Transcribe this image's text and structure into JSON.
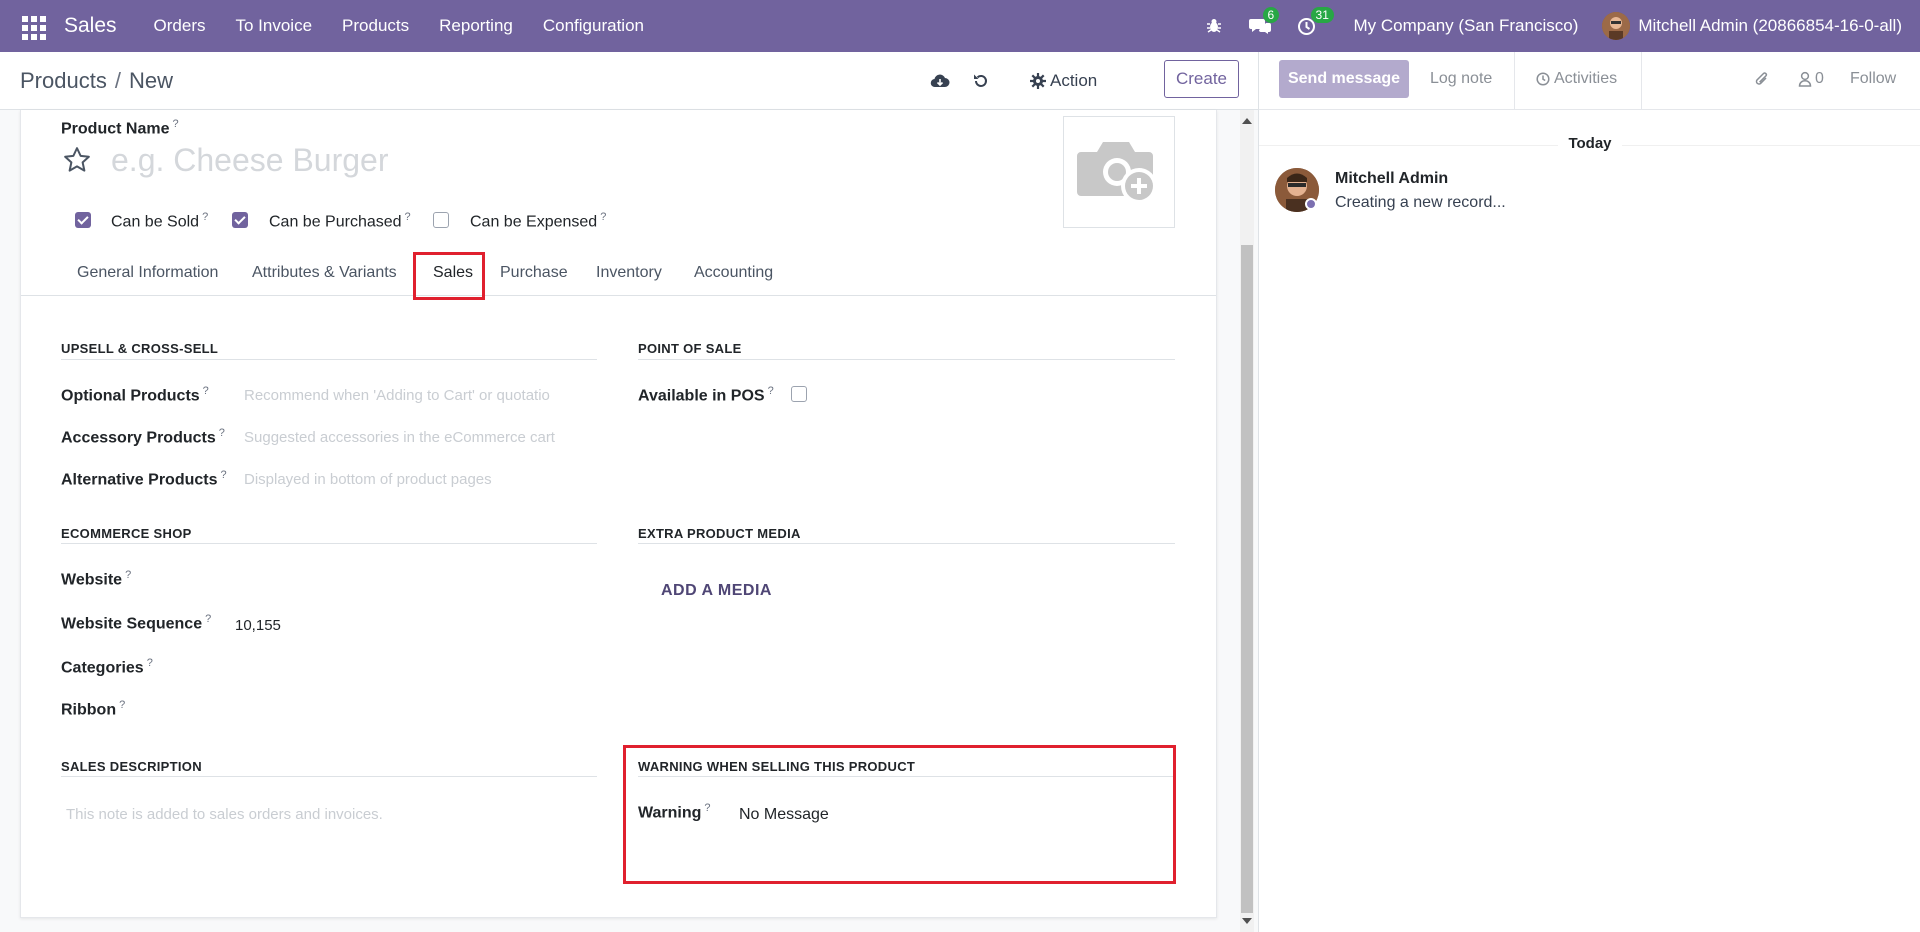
{
  "topnav": {
    "app_name": "Sales",
    "menu": [
      "Orders",
      "To Invoice",
      "Products",
      "Reporting",
      "Configuration"
    ],
    "messages_count": "6",
    "activities_count": "31",
    "company": "My Company (San Francisco)",
    "user": "Mitchell Admin (20866854-16-0-all)"
  },
  "breadcrumb": {
    "parent": "Products",
    "separator": "/",
    "current": "New"
  },
  "control": {
    "action_label": "Action",
    "create_label": "Create"
  },
  "form": {
    "product_name_label": "Product Name",
    "product_name_placeholder": "e.g. Cheese Burger",
    "help_mark": "?",
    "checkboxes": [
      {
        "label": "Can be Sold",
        "checked": true
      },
      {
        "label": "Can be Purchased",
        "checked": true
      },
      {
        "label": "Can be Expensed",
        "checked": false
      }
    ],
    "tabs": [
      "General Information",
      "Attributes & Variants",
      "Sales",
      "Purchase",
      "Inventory",
      "Accounting"
    ],
    "active_tab": "Sales",
    "upsell": {
      "title": "UPSELL & CROSS-SELL",
      "optional_label": "Optional Products",
      "optional_placeholder": "Recommend when 'Adding to Cart' or quotatio",
      "accessory_label": "Accessory Products",
      "accessory_placeholder": "Suggested accessories in the eCommerce cart",
      "alternative_label": "Alternative Products",
      "alternative_placeholder": "Displayed in bottom of product pages"
    },
    "pos": {
      "title": "POINT OF SALE",
      "available_label": "Available in POS",
      "available": false
    },
    "ecommerce": {
      "title": "ECOMMERCE SHOP",
      "website_label": "Website",
      "sequence_label": "Website Sequence",
      "sequence_value": "10,155",
      "categories_label": "Categories",
      "ribbon_label": "Ribbon"
    },
    "media": {
      "title": "EXTRA PRODUCT MEDIA",
      "add_label": "ADD A MEDIA"
    },
    "sales_description": {
      "title": "SALES DESCRIPTION",
      "placeholder": "This note is added to sales orders and invoices."
    },
    "warning": {
      "title": "WARNING WHEN SELLING THIS PRODUCT",
      "label": "Warning",
      "value": "No Message"
    }
  },
  "chatter": {
    "send_message": "Send message",
    "log_note": "Log note",
    "activities": "Activities",
    "followers_count": "0",
    "follow": "Follow",
    "date_header": "Today",
    "message_author": "Mitchell Admin",
    "message_body": "Creating a new record..."
  },
  "colors": {
    "brand": "#71639e",
    "highlight": "#e0202e",
    "badge": "#28a745"
  }
}
